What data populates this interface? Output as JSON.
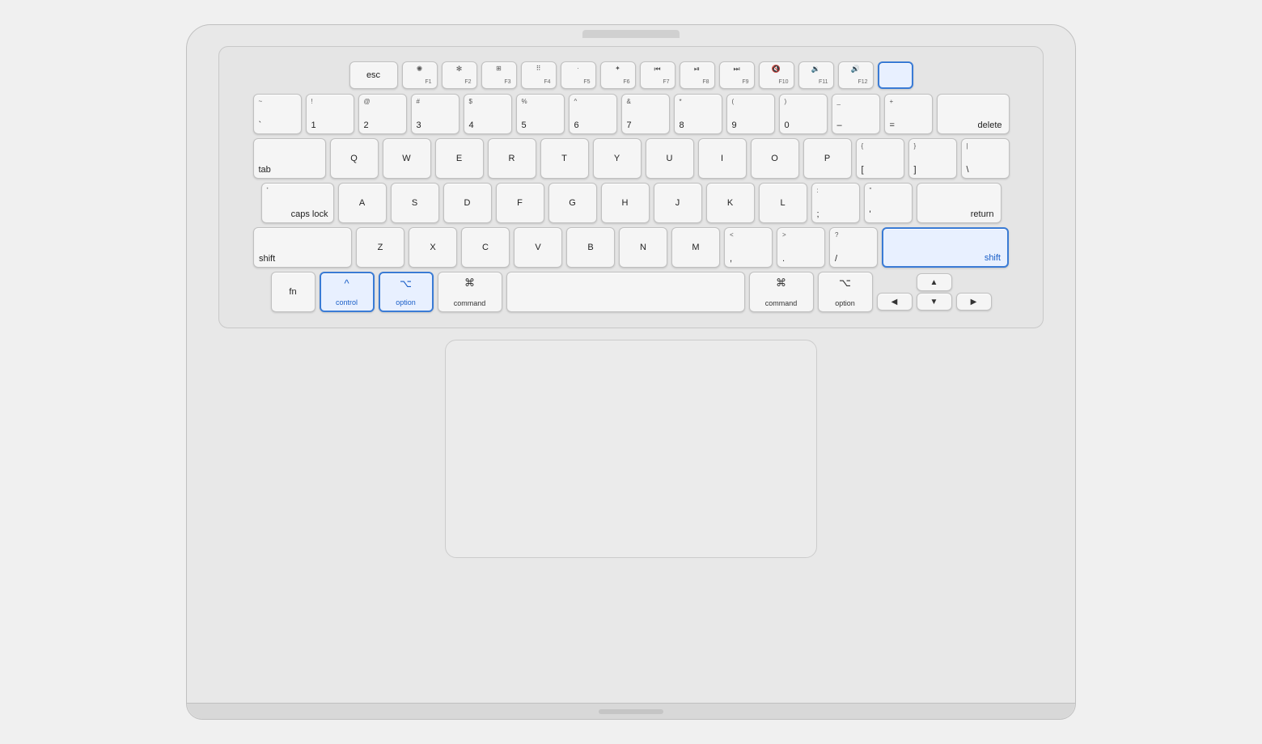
{
  "keyboard": {
    "rows": {
      "fn_row": {
        "keys": [
          {
            "id": "esc",
            "label": "esc",
            "type": "fn-key-wide"
          },
          {
            "id": "f1",
            "top_icon": "☀",
            "bottom": "F1",
            "type": "fn-key"
          },
          {
            "id": "f2",
            "top_icon": "☀☀",
            "bottom": "F2",
            "type": "fn-key"
          },
          {
            "id": "f3",
            "top_icon": "⊞",
            "bottom": "F3",
            "type": "fn-key"
          },
          {
            "id": "f4",
            "top_icon": "⊞⊞",
            "bottom": "F4",
            "type": "fn-key"
          },
          {
            "id": "f5",
            "top_icon": "·⌨",
            "bottom": "F5",
            "type": "fn-key"
          },
          {
            "id": "f6",
            "top_icon": "⌨·",
            "bottom": "F6",
            "type": "fn-key"
          },
          {
            "id": "f7",
            "top_icon": "◄◄",
            "bottom": "F7",
            "type": "fn-key"
          },
          {
            "id": "f8",
            "top_icon": "►II",
            "bottom": "F8",
            "type": "fn-key"
          },
          {
            "id": "f9",
            "top_icon": "►►",
            "bottom": "F9",
            "type": "fn-key"
          },
          {
            "id": "f10",
            "top_icon": "◄",
            "bottom": "F10",
            "type": "fn-key"
          },
          {
            "id": "f11",
            "top_icon": "◄))",
            "bottom": "F11",
            "type": "fn-key"
          },
          {
            "id": "f12",
            "top_icon": "◄))",
            "bottom": "F12",
            "type": "fn-key",
            "highlighted": true
          },
          {
            "id": "power",
            "label": "",
            "type": "fn-key",
            "highlighted": true
          }
        ]
      }
    },
    "highlighted_keys": [
      "control",
      "option-left",
      "shift-right",
      "f12-power"
    ]
  },
  "labels": {
    "esc": "esc",
    "tab": "tab",
    "caps_lock": "caps lock",
    "shift_left": "shift",
    "shift_right": "shift",
    "fn": "fn",
    "control": "control",
    "option_left": "option",
    "command_left": "command",
    "command_right": "command",
    "option_right": "option",
    "return": "return",
    "delete": "delete",
    "control_icon": "^",
    "option_icon": "⌥",
    "command_icon": "⌘"
  }
}
